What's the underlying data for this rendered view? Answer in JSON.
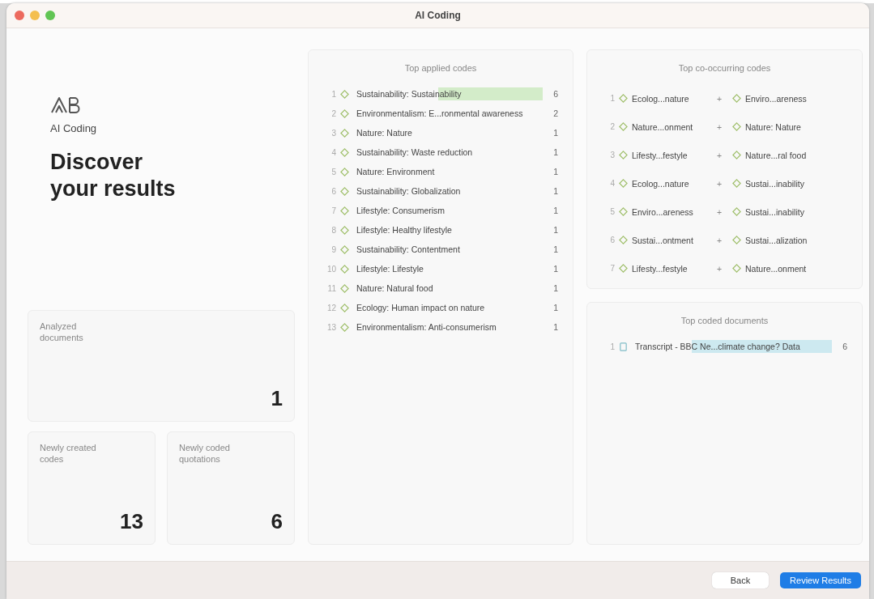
{
  "window": {
    "title": "AI Coding"
  },
  "hero": {
    "app_name": "AI Coding",
    "heading": "Discover your results"
  },
  "stats": [
    {
      "label": "Analyzed documents",
      "value": "1"
    },
    {
      "label": "Newly created codes",
      "value": "13"
    },
    {
      "label": "Newly coded quotations",
      "value": "6"
    }
  ],
  "top_applied_codes": {
    "title": "Top applied codes",
    "rows": [
      {
        "rank": "1",
        "name": "Sustainability: Sustainability",
        "count": "6",
        "selected": true
      },
      {
        "rank": "2",
        "name": "Environmentalism: E...ronmental awareness",
        "count": "2",
        "selected": false
      },
      {
        "rank": "3",
        "name": "Nature: Nature",
        "count": "1",
        "selected": false
      },
      {
        "rank": "4",
        "name": "Sustainability: Waste reduction",
        "count": "1",
        "selected": false
      },
      {
        "rank": "5",
        "name": "Nature: Environment",
        "count": "1",
        "selected": false
      },
      {
        "rank": "6",
        "name": "Sustainability: Globalization",
        "count": "1",
        "selected": false
      },
      {
        "rank": "7",
        "name": "Lifestyle: Consumerism",
        "count": "1",
        "selected": false
      },
      {
        "rank": "8",
        "name": "Lifestyle: Healthy lifestyle",
        "count": "1",
        "selected": false
      },
      {
        "rank": "9",
        "name": "Sustainability: Contentment",
        "count": "1",
        "selected": false
      },
      {
        "rank": "10",
        "name": "Lifestyle: Lifestyle",
        "count": "1",
        "selected": false
      },
      {
        "rank": "11",
        "name": "Nature: Natural food",
        "count": "1",
        "selected": false
      },
      {
        "rank": "12",
        "name": "Ecology: Human impact on nature",
        "count": "1",
        "selected": false
      },
      {
        "rank": "13",
        "name": "Environmentalism: Anti-consumerism",
        "count": "1",
        "selected": false
      }
    ]
  },
  "top_co_occurring_codes": {
    "title": "Top co-occurring codes",
    "rows": [
      {
        "rank": "1",
        "first": "Ecolog...nature",
        "joiner": "+",
        "second": "Enviro...areness"
      },
      {
        "rank": "2",
        "first": "Nature...onment",
        "joiner": "+",
        "second": "Nature: Nature"
      },
      {
        "rank": "3",
        "first": "Lifesty...festyle",
        "joiner": "+",
        "second": "Nature...ral food"
      },
      {
        "rank": "4",
        "first": "Ecolog...nature",
        "joiner": "+",
        "second": "Sustai...inability"
      },
      {
        "rank": "5",
        "first": "Enviro...areness",
        "joiner": "+",
        "second": "Sustai...inability"
      },
      {
        "rank": "6",
        "first": "Sustai...ontment",
        "joiner": "+",
        "second": "Sustai...alization"
      },
      {
        "rank": "7",
        "first": "Lifesty...festyle",
        "joiner": "+",
        "second": "Nature...onment"
      }
    ]
  },
  "top_coded_documents": {
    "title": "Top coded documents",
    "rows": [
      {
        "rank": "1",
        "name": "Transcript - BBC Ne...climate change? Data",
        "count": "6",
        "selected": true
      }
    ]
  },
  "footer": {
    "buttons": [
      {
        "label": "Back",
        "kind": "secondary"
      },
      {
        "label": "Review Results",
        "kind": "primary"
      }
    ]
  }
}
